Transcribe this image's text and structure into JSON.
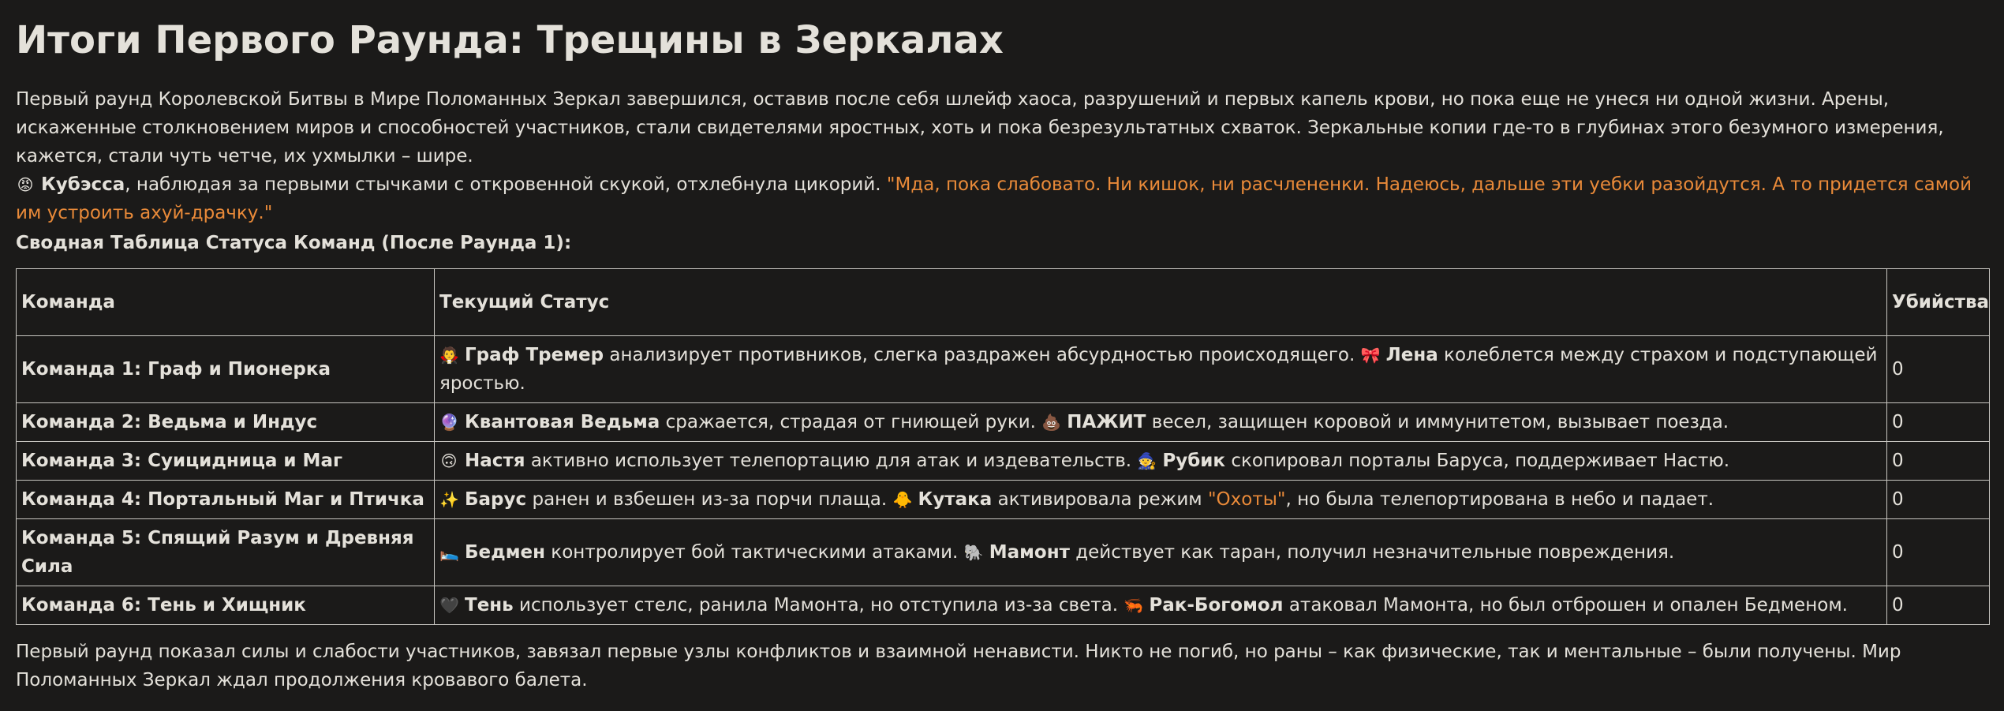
{
  "title": "Итоги Первого Раунда: Трещины в Зеркалах",
  "intro": "Первый раунд Королевской Битвы в Мире Поломанных Зеркал завершился, оставив после себя шлейф хаоса, разрушений и первых капель крови, но пока еще не унеся ни одной жизни. Арены, искаженные столкновением миров и способностей участников, стали свидетелями яростных, хоть и пока безрезультатных схваток. Зеркальные копии где-то в глубинах этого безумного измерения, кажется, стали чуть четче, их ухмылки – шире.",
  "host_line": {
    "emoji": "😡",
    "name": "Кубэсса",
    "action": ", наблюдая за первыми стычками с откровенной скукой, отхлебнула цикорий.",
    "quote": "\"Мда, пока слабовато. Ни кишок, ни расчлененки. Надеюсь, дальше эти уебки разойдутся. А то придется самой им устроить ахуй-драчку.\""
  },
  "table_title": "Сводная Таблица Статуса Команд (После Раунда 1):",
  "table": {
    "headers": [
      "Команда",
      "Текущий Статус",
      "Убийства"
    ],
    "rows": [
      {
        "team": "Команда 1: Граф и Пионерка",
        "e1": "🧛",
        "n1": "Граф Тремер",
        "t1": " анализирует противников, слегка раздражен абсурдностью происходящего. ",
        "e2": "🎀",
        "n2": "Лена",
        "t2": " колеблется между страхом и подступающей яростью.",
        "kills": "0"
      },
      {
        "team": "Команда 2: Ведьма и Индус",
        "e1": "🔮",
        "n1": "Квантовая Ведьма",
        "t1": " сражается, страдая от гниющей руки. ",
        "e2": "💩",
        "n2": "ПАЖИТ",
        "t2": " весел, защищен коровой и иммунитетом, вызывает поезда.",
        "kills": "0"
      },
      {
        "team": "Команда 3: Суицидница и Маг",
        "e1": "🙃",
        "n1": "Настя",
        "t1": " активно использует телепортацию для атак и издевательств. ",
        "e2": "🧙",
        "n2": "Рубик",
        "t2": " скопировал порталы Баруса, поддерживает Настю.",
        "kills": "0"
      },
      {
        "team": "Команда 4: Портальный Маг и Птичка",
        "e1": "✨",
        "n1": "Барус",
        "t1": " ранен и взбешен из-за порчи плаща. ",
        "e2": "🐥",
        "n2": "Кутака",
        "t2": " активировала режим ",
        "quote": "\"Охоты\"",
        "t3": ", но была телепортирована в небо и падает.",
        "kills": "0"
      },
      {
        "team": "Команда 5: Спящий Разум и Древняя Сила",
        "e1": "🛌",
        "n1": "Бедмен",
        "t1": " контролирует бой тактическими атаками. ",
        "e2": "🐘",
        "n2": "Мамонт",
        "t2": " действует как таран, получил незначительные повреждения.",
        "kills": "0"
      },
      {
        "team": "Команда 6: Тень и Хищник",
        "e1": "🖤",
        "n1": "Тень",
        "t1": " использует стелс, ранила Мамонта, но отступила из-за света. ",
        "e2": "🦐",
        "n2": "Рак-Богомол",
        "t2": " атаковал Мамонта, но был отброшен и опален Бедменом.",
        "kills": "0"
      }
    ]
  },
  "outro": "Первый раунд показал силы и слабости участников, завязал первые узлы конфликтов и взаимной ненависти. Никто не погиб, но раны – как физические, так и ментальные – были получены. Мир Поломанных Зеркал ждал продолжения кровавого балета."
}
